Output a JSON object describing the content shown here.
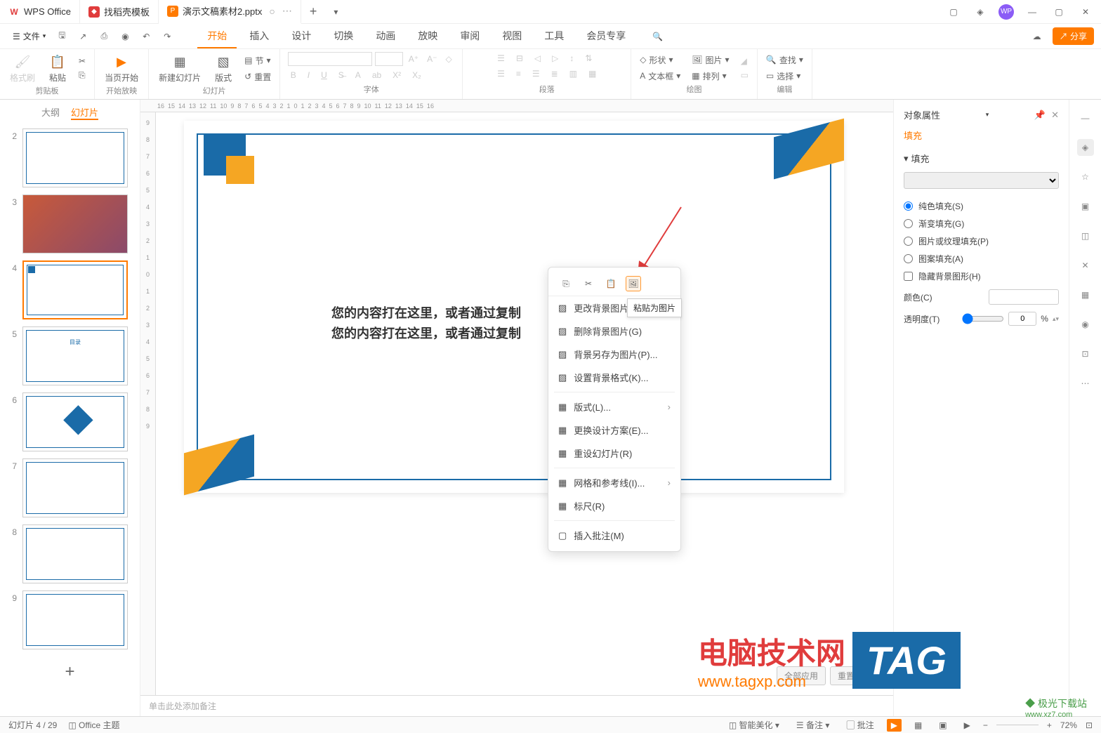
{
  "titlebar": {
    "tabs": [
      {
        "icon": "W",
        "label": "WPS Office"
      },
      {
        "icon": "◆",
        "label": "找稻壳模板"
      },
      {
        "icon": "P",
        "label": "演示文稿素材2.pptx"
      }
    ]
  },
  "menubar": {
    "file": "文件",
    "tabs": [
      "开始",
      "插入",
      "设计",
      "切换",
      "动画",
      "放映",
      "审阅",
      "视图",
      "工具",
      "会员专享"
    ],
    "share": "分享"
  },
  "ribbon": {
    "groups": {
      "clipboard": {
        "label": "剪贴板",
        "format_brush": "格式刷",
        "paste": "粘贴"
      },
      "playback": {
        "label": "开始放映",
        "from_current": "当页开始"
      },
      "slides": {
        "label": "幻灯片",
        "new_slide": "新建幻灯片",
        "layout": "版式",
        "section": "节",
        "reset": "重置"
      },
      "font": {
        "label": "字体"
      },
      "paragraph": {
        "label": "段落"
      },
      "drawing": {
        "label": "绘图",
        "shapes": "形状",
        "textbox": "文本框",
        "picture": "图片",
        "arrange": "排列"
      },
      "editing": {
        "label": "编辑",
        "find": "查找",
        "select": "选择"
      }
    }
  },
  "slidepanel": {
    "tabs": {
      "outline": "大纲",
      "slides": "幻灯片"
    },
    "count": 9
  },
  "slide_content": {
    "line1": "您的内容打在这里，或者通过复制",
    "line2": "您的内容打在这里，或者通过复制"
  },
  "notes_placeholder": "单击此处添加备注",
  "context_menu": {
    "tooltip": "粘贴为图片",
    "items": [
      {
        "icon": "▨",
        "label": "更改背景图片"
      },
      {
        "icon": "▨",
        "label": "删除背景图片(G)"
      },
      {
        "icon": "▨",
        "label": "背景另存为图片(P)..."
      },
      {
        "icon": "▨",
        "label": "设置背景格式(K)..."
      },
      {
        "icon": "▦",
        "label": "版式(L)...",
        "arrow": true
      },
      {
        "icon": "▦",
        "label": "更换设计方案(E)..."
      },
      {
        "icon": "▦",
        "label": "重设幻灯片(R)"
      },
      {
        "icon": "▦",
        "label": "网格和参考线(I)...",
        "arrow": true
      },
      {
        "icon": "▦",
        "label": "标尺(R)"
      },
      {
        "icon": "▢",
        "label": "插入批注(M)"
      }
    ]
  },
  "rightpanel": {
    "title": "对象属性",
    "tab": "填充",
    "section": "填充",
    "options": {
      "solid": "纯色填充(S)",
      "gradient": "渐变填充(G)",
      "picture": "图片或纹理填充(P)",
      "pattern": "图案填充(A)",
      "hide": "隐藏背景图形(H)"
    },
    "color_label": "颜色(C)",
    "opacity_label": "透明度(T)",
    "opacity_value": "0",
    "opacity_unit": "%"
  },
  "bg_buttons": {
    "apply_all": "全部应用",
    "reset": "重置背景"
  },
  "statusbar": {
    "slide_info": "幻灯片 4 / 29",
    "theme": "Office 主题",
    "beautify": "智能美化",
    "notes": "备注",
    "comments": "批注",
    "zoom": "72%"
  },
  "watermark": {
    "main": "电脑技术网",
    "sub": "www.tagxp.com",
    "tag": "TAG",
    "dl": "◆ 极光下载站",
    "url": "www.xz7.com"
  }
}
